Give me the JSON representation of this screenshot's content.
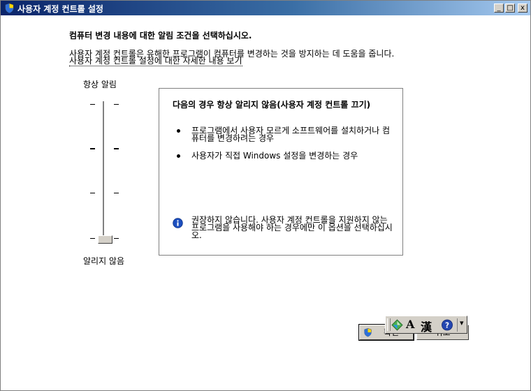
{
  "window": {
    "title": "사용자 계정 컨트롤 설정",
    "controls": {
      "minimize": "_",
      "maximize": "□",
      "close": "x"
    }
  },
  "main": {
    "heading": "컴퓨터 변경 내용에 대한 알림 조건을 선택하십시오.",
    "description": "사용자 계정 컨트롤은 유해한 프로그램이 컴퓨터를 변경하는 것을 방지하는 데 도움을 줍니다.",
    "link": "사용자 계정 컨트롤 설정에 대한 자세한 내용 보기"
  },
  "slider": {
    "top_label": "항상 알림",
    "bottom_label": "알리지 않음",
    "level": 0,
    "levels": 4
  },
  "info": {
    "title": "다음의 경우 항상 알리지 않음(사용자 계정 컨트롤 끄기)",
    "bullets": [
      "프로그램에서 사용자 모르게 소프트웨어를 설치하거나 컴퓨터를 변경하려는 경우",
      "사용자가 직접 Windows 설정을 변경하는 경우"
    ],
    "note": "권장하지 않습니다. 사용자 계정 컨트롤을 지원하지 않는 프로그램을 사용해야 하는 경우에만 이 옵션을 선택하십시오."
  },
  "buttons": {
    "ok": "확인",
    "cancel": "취소"
  },
  "ime": {
    "mode": "A",
    "hanja": "漢",
    "menu": "▾"
  },
  "colors": {
    "titlebar": "#0a246a",
    "face": "#d4d0c8",
    "info_icon": "#1c4fbf"
  }
}
